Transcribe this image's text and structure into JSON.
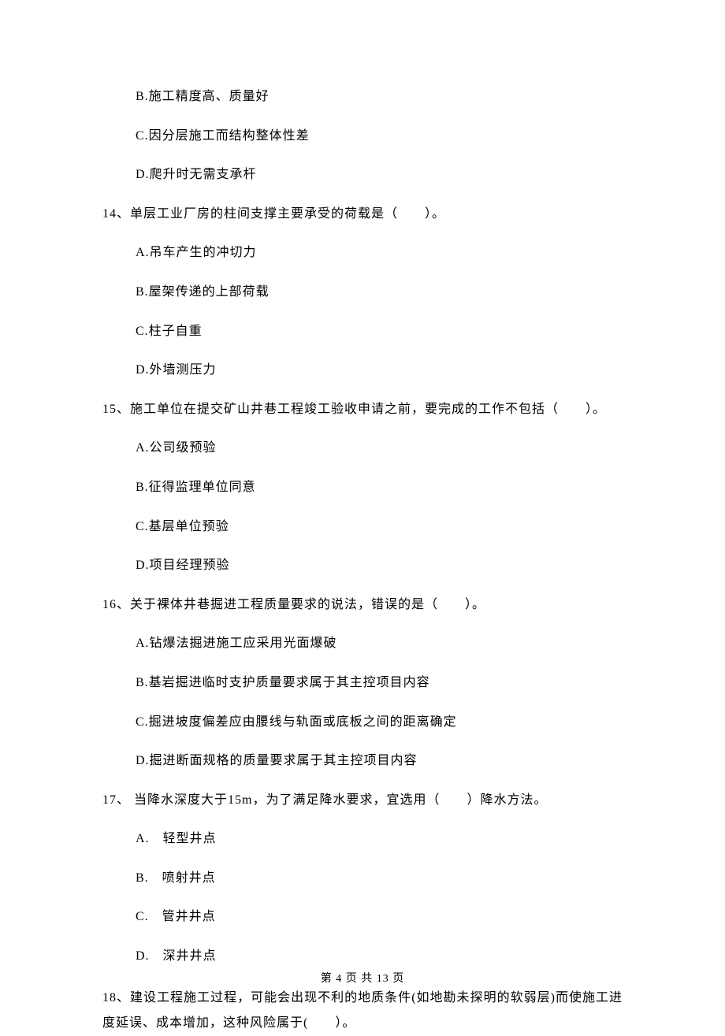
{
  "q13_continued": {
    "options": {
      "b": "B.施工精度高、质量好",
      "c": "C.因分层施工而结构整体性差",
      "d": "D.爬升时无需支承杆"
    }
  },
  "q14": {
    "text": "14、单层工业厂房的柱间支撑主要承受的荷载是（　　）。",
    "options": {
      "a": "A.吊车产生的冲切力",
      "b": "B.屋架传递的上部荷载",
      "c": "C.柱子自重",
      "d": "D.外墙测压力"
    }
  },
  "q15": {
    "text": "15、施工单位在提交矿山井巷工程竣工验收申请之前，要完成的工作不包括（　　）。",
    "options": {
      "a": "A.公司级预验",
      "b": "B.征得监理单位同意",
      "c": "C.基层单位预验",
      "d": "D.项目经理预验"
    }
  },
  "q16": {
    "text": "16、关于裸体井巷掘进工程质量要求的说法，错误的是（　　）。",
    "options": {
      "a": "A.钻爆法掘进施工应采用光面爆破",
      "b": "B.基岩掘进临时支护质量要求属于其主控项目内容",
      "c": "C.掘进坡度偏差应由腰线与轨面或底板之间的距离确定",
      "d": "D.掘进断面规格的质量要求属于其主控项目内容"
    }
  },
  "q17": {
    "text": "17、 当降水深度大于15m，为了满足降水要求，宜选用（　　）降水方法。",
    "options": {
      "a": "A.　轻型井点",
      "b": "B.　喷射井点",
      "c": "C.　管井井点",
      "d": "D.　深井井点"
    }
  },
  "q18": {
    "text": "18、建设工程施工过程，可能会出现不利的地质条件(如地勘未探明的软弱层)而使施工进度延误、成本增加，这种风险属于(　　）。"
  },
  "footer": "第 4 页 共 13 页"
}
